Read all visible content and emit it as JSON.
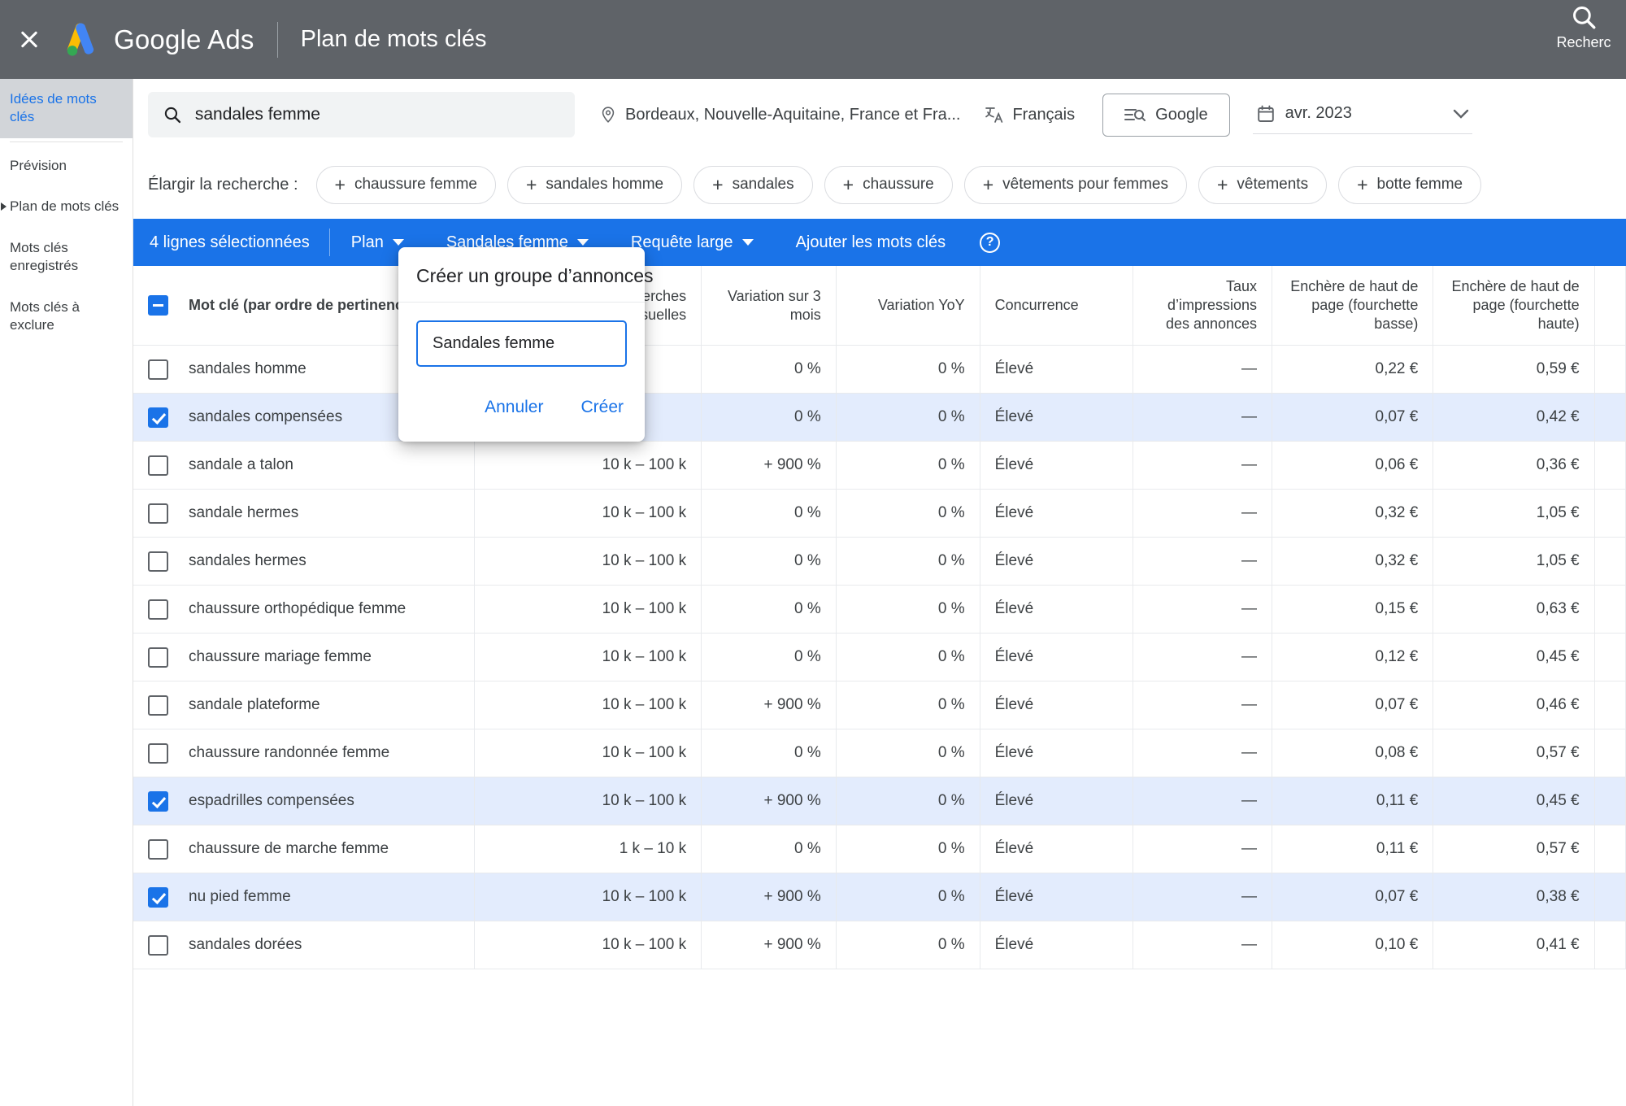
{
  "topbar": {
    "close_label": "close-icon",
    "brand": "Google Ads",
    "page_title": "Plan de mots clés",
    "search_label": "Recherc",
    "bg_color": "#5f6368"
  },
  "sidebar": {
    "items": [
      {
        "label": "Idées de mots clés",
        "active": true,
        "expandable": false
      },
      {
        "label": "Prévision",
        "active": false,
        "expandable": false
      },
      {
        "label": "Plan de mots clés",
        "active": false,
        "expandable": true
      },
      {
        "label": "Mots clés enregistrés",
        "active": false,
        "expandable": false
      },
      {
        "label": "Mots clés à exclure",
        "active": false,
        "expandable": false
      }
    ]
  },
  "filters": {
    "search_value": "sandales femme",
    "search_placeholder": "",
    "location": "Bordeaux, Nouvelle-Aquitaine, France et Fra...",
    "language": "Français",
    "network": "Google",
    "date_range": "avr. 2023"
  },
  "expand": {
    "label": "Élargir la recherche :",
    "chips": [
      "chaussure femme",
      "sandales homme",
      "sandales",
      "chaussure",
      "vêtements pour femmes",
      "vêtements",
      "botte femme"
    ]
  },
  "actionbar": {
    "selected_count": "4 lignes sélectionnées",
    "plan": "Plan",
    "ad_group": "Sandales femme",
    "match_type": "Requête large",
    "add_keywords": "Ajouter les mots clés",
    "help": "?",
    "accent_color": "#1a73e8"
  },
  "modal": {
    "title": "Créer un groupe d’annonces",
    "input_value": "Sandales femme",
    "input_placeholder": "",
    "cancel": "Annuler",
    "create": "Créer"
  },
  "table": {
    "headers": {
      "keyword": "Mot clé (par ordre de pertinence)",
      "volume": "Moy. des recherches mensuelles",
      "change": "Variation sur 3 mois",
      "yoy": "Variation YoY",
      "competition": "Concurrence",
      "impression_share": "Taux d’impressions des annonces",
      "bid_low": "Enchère de haut de page (fourchette basse)",
      "bid_high": "Enchère de haut de page (fourchette haute)"
    },
    "rows": [
      {
        "selected": false,
        "keyword": "sandales homme",
        "volume": "",
        "change": "0 %",
        "yoy": "0 %",
        "competition": "Élevé",
        "impression_share": "—",
        "bid_low": "0,22 €",
        "bid_high": "0,59 €"
      },
      {
        "selected": true,
        "keyword": "sandales compensées",
        "volume": "",
        "change": "0 %",
        "yoy": "0 %",
        "competition": "Élevé",
        "impression_share": "—",
        "bid_low": "0,07 €",
        "bid_high": "0,42 €"
      },
      {
        "selected": false,
        "keyword": "sandale a talon",
        "volume": "10 k – 100 k",
        "change": "+ 900 %",
        "yoy": "0 %",
        "competition": "Élevé",
        "impression_share": "—",
        "bid_low": "0,06 €",
        "bid_high": "0,36 €"
      },
      {
        "selected": false,
        "keyword": "sandale hermes",
        "volume": "10 k – 100 k",
        "change": "0 %",
        "yoy": "0 %",
        "competition": "Élevé",
        "impression_share": "—",
        "bid_low": "0,32 €",
        "bid_high": "1,05 €"
      },
      {
        "selected": false,
        "keyword": "sandales hermes",
        "volume": "10 k – 100 k",
        "change": "0 %",
        "yoy": "0 %",
        "competition": "Élevé",
        "impression_share": "—",
        "bid_low": "0,32 €",
        "bid_high": "1,05 €"
      },
      {
        "selected": false,
        "keyword": "chaussure orthopédique femme",
        "volume": "10 k – 100 k",
        "change": "0 %",
        "yoy": "0 %",
        "competition": "Élevé",
        "impression_share": "—",
        "bid_low": "0,15 €",
        "bid_high": "0,63 €"
      },
      {
        "selected": false,
        "keyword": "chaussure mariage femme",
        "volume": "10 k – 100 k",
        "change": "0 %",
        "yoy": "0 %",
        "competition": "Élevé",
        "impression_share": "—",
        "bid_low": "0,12 €",
        "bid_high": "0,45 €"
      },
      {
        "selected": false,
        "keyword": "sandale plateforme",
        "volume": "10 k – 100 k",
        "change": "+ 900 %",
        "yoy": "0 %",
        "competition": "Élevé",
        "impression_share": "—",
        "bid_low": "0,07 €",
        "bid_high": "0,46 €"
      },
      {
        "selected": false,
        "keyword": "chaussure randonnée femme",
        "volume": "10 k – 100 k",
        "change": "0 %",
        "yoy": "0 %",
        "competition": "Élevé",
        "impression_share": "—",
        "bid_low": "0,08 €",
        "bid_high": "0,57 €"
      },
      {
        "selected": true,
        "keyword": "espadrilles compensées",
        "volume": "10 k – 100 k",
        "change": "+ 900 %",
        "yoy": "0 %",
        "competition": "Élevé",
        "impression_share": "—",
        "bid_low": "0,11 €",
        "bid_high": "0,45 €"
      },
      {
        "selected": false,
        "keyword": "chaussure de marche femme",
        "volume": "1 k – 10 k",
        "change": "0 %",
        "yoy": "0 %",
        "competition": "Élevé",
        "impression_share": "—",
        "bid_low": "0,11 €",
        "bid_high": "0,57 €"
      },
      {
        "selected": true,
        "keyword": "nu pied femme",
        "volume": "10 k – 100 k",
        "change": "+ 900 %",
        "yoy": "0 %",
        "competition": "Élevé",
        "impression_share": "—",
        "bid_low": "0,07 €",
        "bid_high": "0,38 €"
      },
      {
        "selected": false,
        "keyword": "sandales dorées",
        "volume": "10 k – 100 k",
        "change": "+ 900 %",
        "yoy": "0 %",
        "competition": "Élevé",
        "impression_share": "—",
        "bid_low": "0,10 €",
        "bid_high": "0,41 €"
      }
    ]
  }
}
